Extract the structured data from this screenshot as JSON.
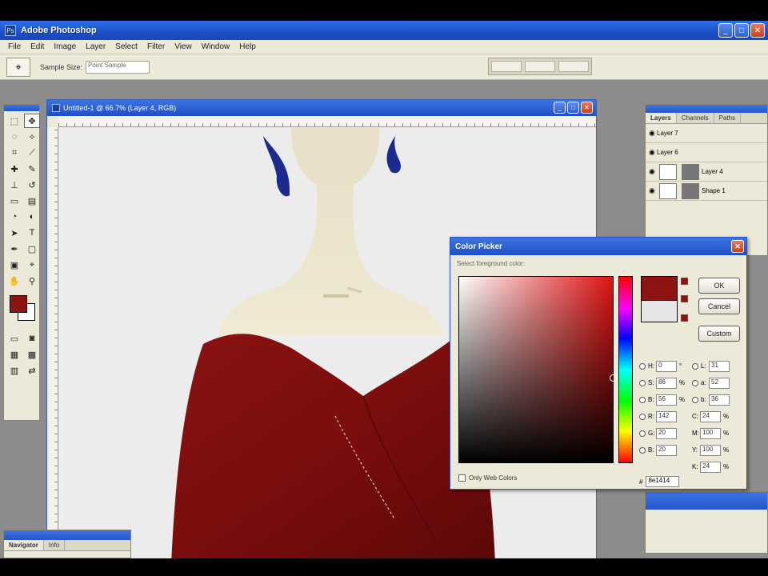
{
  "app": {
    "title": "Adobe Photoshop",
    "menus": [
      "File",
      "Edit",
      "Image",
      "Layer",
      "Select",
      "Filter",
      "View",
      "Window",
      "Help"
    ]
  },
  "options_bar": {
    "label": "Sample Size:",
    "value": "Point Sample"
  },
  "document": {
    "title": "Untitled-1 @ 66.7% (Layer 4, RGB)"
  },
  "layers_panel": {
    "tabs": [
      "Layers",
      "Channels",
      "Paths"
    ],
    "layers": [
      {
        "name": "Layer 7"
      },
      {
        "name": "Layer 6"
      },
      {
        "name": "Layer 4"
      },
      {
        "name": "Shape 1"
      }
    ]
  },
  "color_picker": {
    "title": "Color Picker",
    "subtitle": "Select foreground color:",
    "ok_label": "OK",
    "cancel_label": "Cancel",
    "custom_label": "Custom",
    "only_web_label": "Only Web Colors",
    "hsb": [
      {
        "label": "H:",
        "value": "0",
        "unit": "°"
      },
      {
        "label": "S:",
        "value": "86",
        "unit": "%"
      },
      {
        "label": "B:",
        "value": "56",
        "unit": "%"
      }
    ],
    "rgb": [
      {
        "label": "R:",
        "value": "142"
      },
      {
        "label": "G:",
        "value": "20"
      },
      {
        "label": "B:",
        "value": "20"
      }
    ],
    "lab": [
      {
        "label": "L:",
        "value": "31"
      },
      {
        "label": "a:",
        "value": "52"
      },
      {
        "label": "b:",
        "value": "36"
      }
    ],
    "cmyk": [
      {
        "label": "C:",
        "value": "24",
        "unit": "%"
      },
      {
        "label": "M:",
        "value": "100",
        "unit": "%"
      },
      {
        "label": "Y:",
        "value": "100",
        "unit": "%"
      },
      {
        "label": "K:",
        "value": "24",
        "unit": "%"
      }
    ],
    "hex_label": "#",
    "hex_value": "8e1414",
    "new_color": "#8e1414",
    "current_color": "#e6e6e6"
  },
  "colors": {
    "foreground": "#8e1414",
    "background": "#ffffff",
    "titlebar": "#2556c8"
  },
  "navigator": {
    "tabs": [
      "Navigator",
      "Info"
    ]
  }
}
